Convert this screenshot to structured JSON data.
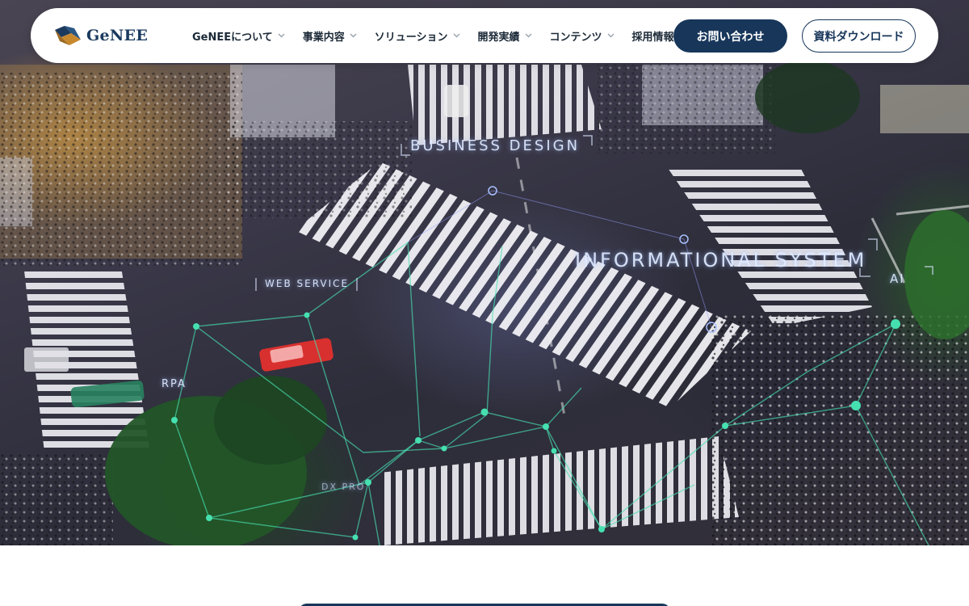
{
  "brand": {
    "name": "GeNEE",
    "accent_color": "#17365a",
    "logo_gold": "#c8892e"
  },
  "nav": {
    "items": [
      {
        "label": "GeNEEについて",
        "has_dropdown": true
      },
      {
        "label": "事業内容",
        "has_dropdown": true
      },
      {
        "label": "ソリューション",
        "has_dropdown": true
      },
      {
        "label": "開発実績",
        "has_dropdown": true
      },
      {
        "label": "コンテンツ",
        "has_dropdown": true
      },
      {
        "label": "採用情報",
        "has_dropdown": false
      }
    ],
    "chevron_icon": "chevron-down-icon"
  },
  "actions": {
    "contact_label": "お問い合わせ",
    "download_label": "資料ダウンロード"
  },
  "hero": {
    "overlay_labels": {
      "business_design": "BUSINESS DESIGN",
      "informational_system": "INFORMATIONAL SYSTEM",
      "web_service": "WEB SERVICE",
      "rpa": "RPA",
      "ai": "AI",
      "dx": "DX PRO"
    },
    "network_color": "#46e0b0"
  }
}
